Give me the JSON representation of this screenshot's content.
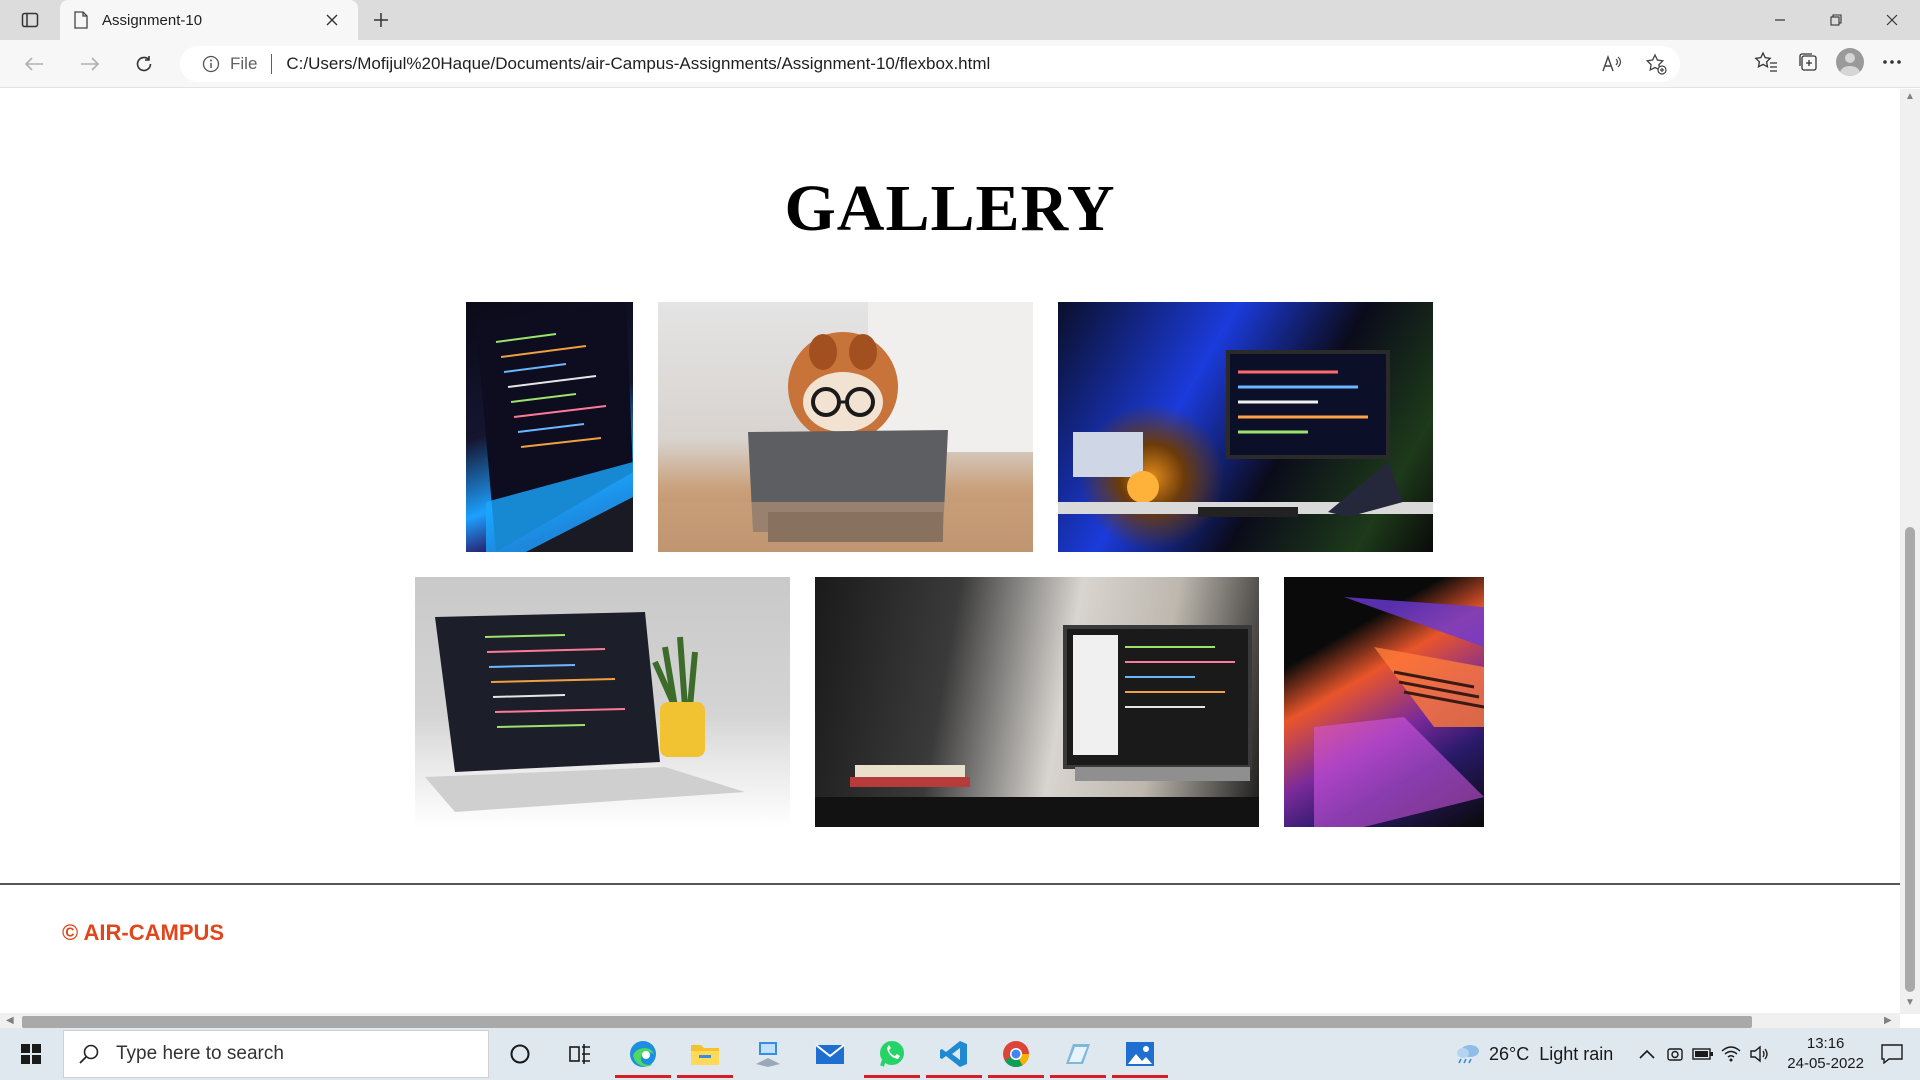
{
  "browser": {
    "tab_title": "Assignment-10",
    "address_prefix": "File",
    "url": "C:/Users/Mofijul%20Haque/Documents/air-Campus-Assignments/Assignment-10/flexbox.html"
  },
  "page": {
    "title": "GALLERY",
    "footer": "© AIR-CAMPUS",
    "photos": [
      {
        "name": "laptop-code-closeup-photo"
      },
      {
        "name": "dog-with-glasses-photo"
      },
      {
        "name": "desk-setup-monitors-photo"
      },
      {
        "name": "laptop-with-plant-photo"
      },
      {
        "name": "laptop-by-wall-photo"
      },
      {
        "name": "laptop-colorful-photo"
      }
    ]
  },
  "taskbar": {
    "search_placeholder": "Type here to search",
    "weather_temp": "26°C",
    "weather_desc": "Light rain",
    "time": "13:16",
    "date": "24-05-2022",
    "accent_color": "#d61f25"
  },
  "colors": {
    "footer_text": "#e0461c",
    "tabbar_bg": "#dcdcdc",
    "taskbar_bg": "#dfe7ef"
  }
}
